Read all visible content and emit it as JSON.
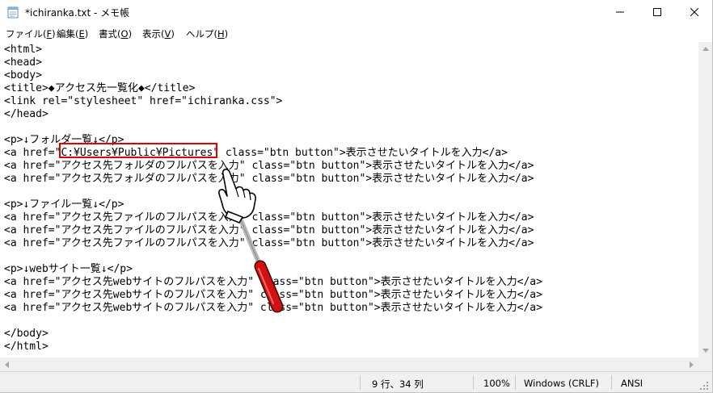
{
  "window": {
    "title": "*ichiranka.txt - メモ帳"
  },
  "menu": [
    {
      "label": "ファイル(",
      "key": "F",
      "suffix": ")"
    },
    {
      "label": "編集(",
      "key": "E",
      "suffix": ")"
    },
    {
      "label": "書式(",
      "key": "O",
      "suffix": ")"
    },
    {
      "label": "表示(",
      "key": "V",
      "suffix": ")"
    },
    {
      "label": "ヘルプ(",
      "key": "H",
      "suffix": ")"
    }
  ],
  "editor": {
    "lines": [
      "<html>",
      "<head>",
      "<body>",
      "<title>◆アクセス先一覧化◆</title>",
      "<link rel=\"stylesheet\" href=\"ichiranka.css\">",
      "</head>",
      "",
      "<p>↓フォルダ一覧↓</p>",
      "<a href=\"C:¥Users¥Public¥Pictures\" class=\"btn button\">表示させたいタイトルを入力</a>",
      "<a href=\"アクセス先フォルダのフルパスを入力\" class=\"btn button\">表示させたいタイトルを入力</a>",
      "<a href=\"アクセス先フォルダのフルパスを入力\" class=\"btn button\">表示させたいタイトルを入力</a>",
      "",
      "<p>↓ファイル一覧↓</p>",
      "<a href=\"アクセス先ファイルのフルパスを入力\" class=\"btn button\">表示させたいタイトルを入力</a>",
      "<a href=\"アクセス先ファイルのフルパスを入力\" class=\"btn button\">表示させたいタイトルを入力</a>",
      "<a href=\"アクセス先ファイルのフルパスを入力\" class=\"btn button\">表示させたいタイトルを入力</a>",
      "",
      "<p>↓webサイト一覧↓</p>",
      "<a href=\"アクセス先webサイトのフルパスを入力\" class=\"btn button\">表示させたいタイトルを入力</a>",
      "<a href=\"アクセス先webサイトのフルパスを入力\" class=\"btn button\">表示させたいタイトルを入力</a>",
      "<a href=\"アクセス先webサイトのフルパスを入力\" class=\"btn button\">表示させたいタイトルを入力</a>",
      "",
      "</body>",
      "</html>"
    ]
  },
  "status": {
    "position": "9 行、34 列",
    "zoom": "100%",
    "line_ending": "Windows (CRLF)",
    "encoding": "ANSI"
  },
  "colors": {
    "highlight": "#e00000"
  },
  "icons": {
    "app": "notepad-icon",
    "minimize": "minimize-icon",
    "maximize": "maximize-icon",
    "close": "close-icon",
    "pointer": "pointing-hand-icon"
  }
}
